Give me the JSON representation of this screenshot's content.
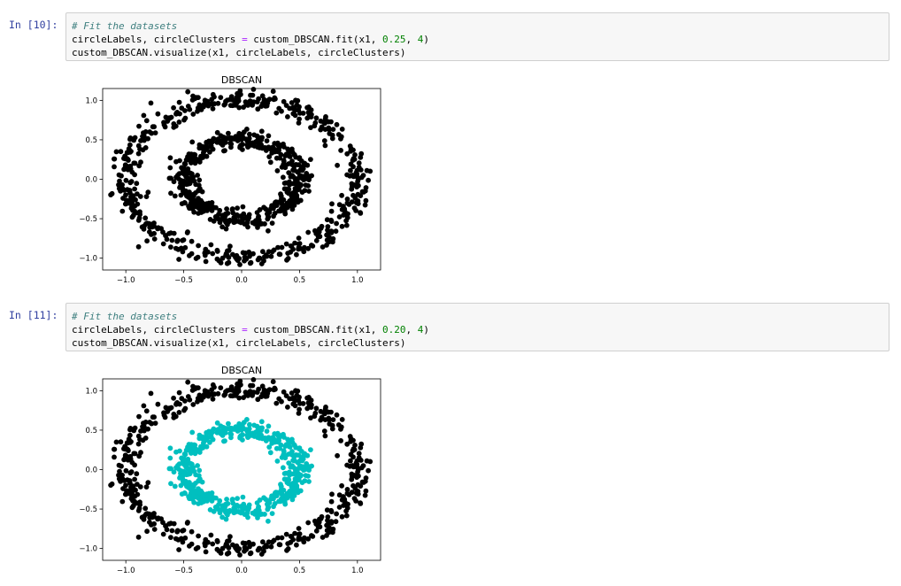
{
  "cells": [
    {
      "prompt": "In [10]:",
      "comment": "# Fit the datasets",
      "line2": {
        "pre": "circleLabels, circleClusters ",
        "op": "=",
        "mid": " custom_DBSCAN.fit(x1, ",
        "n1": "0.25",
        "sep": ", ",
        "n2": "4",
        "post": ")"
      },
      "line3": "custom_DBSCAN.visualize(x1, circleLabels, circleClusters)"
    },
    {
      "prompt": "In [11]:",
      "comment": "# Fit the datasets",
      "line2": {
        "pre": "circleLabels, circleClusters ",
        "op": "=",
        "mid": " custom_DBSCAN.fit(x1, ",
        "n1": "0.20",
        "sep": ", ",
        "n2": "4",
        "post": ")"
      },
      "line3": "custom_DBSCAN.visualize(x1, circleLabels, circleClusters)"
    }
  ],
  "chart_data": [
    {
      "type": "scatter",
      "title": "DBSCAN",
      "xlim": [
        -1.2,
        1.2
      ],
      "ylim": [
        -1.15,
        1.15
      ],
      "xticks": [
        "−1.0",
        "−0.5",
        "0.0",
        "0.5",
        "1.0"
      ],
      "xtick_values": [
        -1.0,
        -0.5,
        0.0,
        0.5,
        1.0
      ],
      "yticks": [
        "1.0",
        "0.5",
        "0.0",
        "−0.5",
        "−1.0"
      ],
      "ytick_values": [
        1.0,
        0.5,
        0.0,
        -0.5,
        -1.0
      ],
      "series": [
        {
          "ring": "outer",
          "radius": 1.0,
          "noise": 0.06,
          "count": 520,
          "color": "#000000",
          "cluster": 0
        },
        {
          "ring": "inner",
          "radius": 0.5,
          "noise": 0.06,
          "count": 520,
          "color": "#000000",
          "cluster": 0
        }
      ]
    },
    {
      "type": "scatter",
      "title": "DBSCAN",
      "xlim": [
        -1.2,
        1.2
      ],
      "ylim": [
        -1.15,
        1.15
      ],
      "xticks": [
        "−1.0",
        "−0.5",
        "0.0",
        "0.5",
        "1.0"
      ],
      "xtick_values": [
        -1.0,
        -0.5,
        0.0,
        0.5,
        1.0
      ],
      "yticks": [
        "1.0",
        "0.5",
        "0.0",
        "−0.5",
        "−1.0"
      ],
      "ytick_values": [
        1.0,
        0.5,
        0.0,
        -0.5,
        -1.0
      ],
      "series": [
        {
          "ring": "outer",
          "radius": 1.0,
          "noise": 0.06,
          "count": 520,
          "color": "#000000",
          "cluster": 0
        },
        {
          "ring": "inner",
          "radius": 0.5,
          "noise": 0.06,
          "count": 520,
          "color": "#00bfbf",
          "cluster": 1
        }
      ]
    }
  ]
}
